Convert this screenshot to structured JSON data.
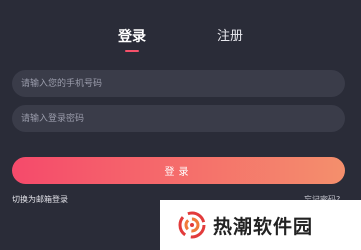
{
  "tabs": {
    "login": "登录",
    "register": "注册",
    "active_color": "#f5516a"
  },
  "form": {
    "phone_placeholder": "请输入您的手机号码",
    "password_placeholder": "请输入登录密码",
    "login_button": "登录",
    "switch_email": "切换为邮箱登录",
    "forgot_password": "忘记密码?"
  },
  "watermark": {
    "text": "热潮软件园",
    "logo_icon": "flame-swirl-logo",
    "logo_color": "#e23b3b"
  },
  "colors": {
    "background": "#2a2c38",
    "field": "#3a3c49",
    "button_gradient_start": "#f54a6b",
    "button_gradient_end": "#f48f6c"
  }
}
